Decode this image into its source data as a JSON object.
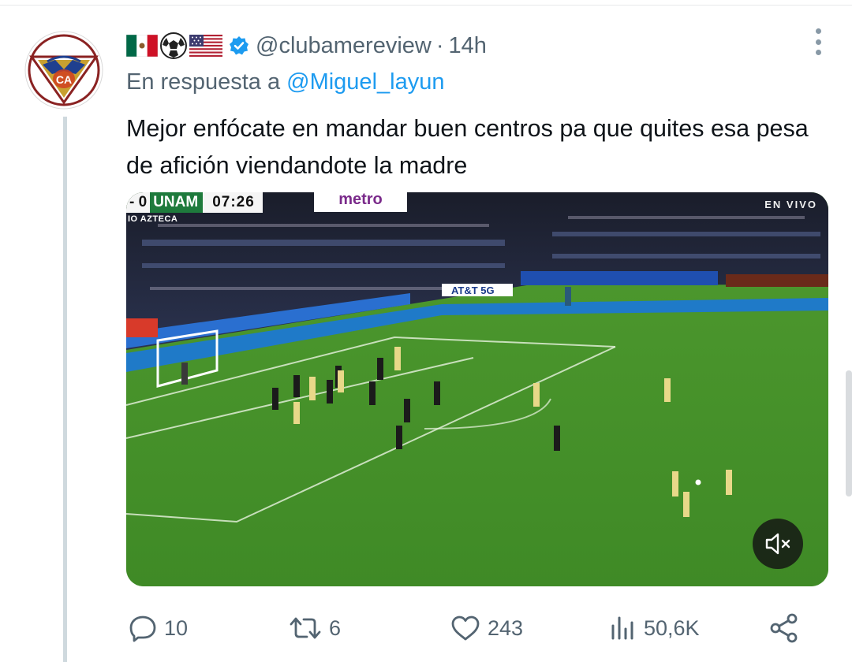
{
  "tweet": {
    "handle": "@clubamereview",
    "separator": "·",
    "time": "14h",
    "reply_prefix": "En respuesta a",
    "reply_mention": "@Miguel_layun",
    "text": "Mejor enfócate en mandar buen centros pa que quites esa pesa de afición viendandote la madre"
  },
  "video": {
    "score": "- 0",
    "team": "UNAM",
    "clock": "07:26",
    "venue": "IO AZTECA",
    "sponsor": "metro",
    "live_label": "EN VIVO",
    "mute_icon": "volume-muted-icon"
  },
  "actions": {
    "replies": "10",
    "retweets": "6",
    "likes": "243",
    "views": "50,6K"
  },
  "icons": {
    "verified": "verified-badge-icon",
    "more": "more-options-icon",
    "reply": "reply-icon",
    "retweet": "retweet-icon",
    "like": "heart-icon",
    "views": "views-icon",
    "share": "share-icon"
  },
  "colors": {
    "accent": "#1d9bf0",
    "secondary_text": "#536471",
    "primary_text": "#0f1419",
    "thread_line": "#cfd9de"
  }
}
